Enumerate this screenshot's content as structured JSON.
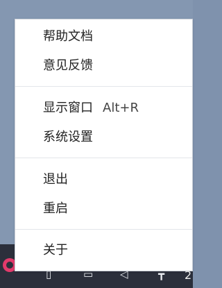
{
  "menu": {
    "groups": [
      {
        "items": [
          {
            "label": "帮助文档"
          },
          {
            "label": "意见反馈"
          }
        ]
      },
      {
        "items": [
          {
            "label": "显示窗口",
            "shortcut": "Alt+R"
          },
          {
            "label": "系统设置"
          }
        ]
      },
      {
        "items": [
          {
            "label": "退出"
          },
          {
            "label": "重启"
          }
        ]
      },
      {
        "items": [
          {
            "label": "关于"
          }
        ]
      }
    ]
  },
  "taskbar": {
    "clock_fragment": "2",
    "icons": [
      "app-logo-icon",
      "phone-icon",
      "monitor-icon",
      "speaker-icon",
      "pin-icon"
    ]
  }
}
